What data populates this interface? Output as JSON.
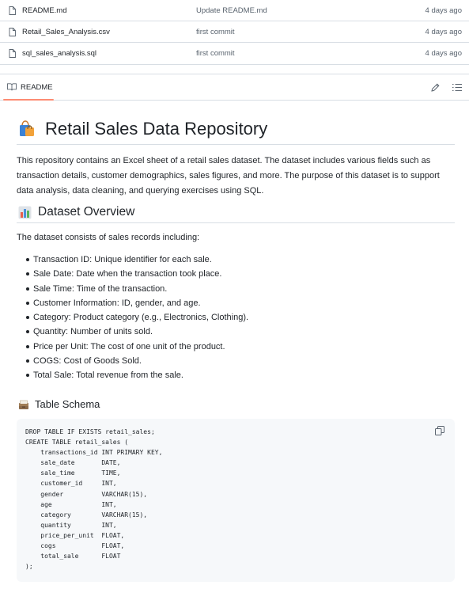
{
  "files": [
    {
      "name": "README.md",
      "commit": "Update README.md",
      "date": "4 days ago"
    },
    {
      "name": "Retail_Sales_Analysis.csv",
      "commit": "first commit",
      "date": "4 days ago"
    },
    {
      "name": "sql_sales_analysis.sql",
      "commit": "first commit",
      "date": "4 days ago"
    }
  ],
  "readme_header": {
    "tab_label": "README"
  },
  "readme": {
    "title": "Retail Sales Data Repository",
    "intro": "This repository contains an Excel sheet of a retail sales dataset. The dataset includes various fields such as transaction details, customer demographics, sales figures, and more. The purpose of this dataset is to support data analysis, data cleaning, and querying exercises using SQL.",
    "overview_heading": "Dataset Overview",
    "overview_intro": "The dataset consists of sales records including:",
    "features": [
      "Transaction ID: Unique identifier for each sale.",
      "Sale Date: Date when the transaction took place.",
      "Sale Time: Time of the transaction.",
      "Customer Information: ID, gender, and age.",
      "Category: Product category (e.g., Electronics, Clothing).",
      "Quantity: Number of units sold.",
      "Price per Unit: The cost of one unit of the product.",
      "COGS: Cost of Goods Sold.",
      "Total Sale: Total revenue from the sale."
    ],
    "schema_heading": "Table Schema",
    "code": "DROP TABLE IF EXISTS retail_sales;\nCREATE TABLE retail_sales (\n    transactions_id INT PRIMARY KEY,\n    sale_date       DATE,\n    sale_time       TIME,\n    customer_id     INT,\n    gender          VARCHAR(15),\n    age             INT,\n    category        VARCHAR(15),\n    quantity        INT,\n    price_per_unit  FLOAT,\n    cogs            FLOAT,\n    total_sale      FLOAT\n);"
  },
  "icons": {
    "file": "file-icon",
    "readme_tab": "book-icon",
    "edit": "pencil-icon",
    "outline": "list-icon",
    "title_emoji": "shopping-bags-icon",
    "overview_emoji": "bar-chart-icon",
    "schema_emoji": "card-file-box-icon",
    "copy": "copy-icon"
  },
  "colors": {
    "border": "#d8dee4",
    "muted_text": "#59636e",
    "tab_underline": "#fd8c73",
    "code_bg": "#f6f8fa"
  }
}
